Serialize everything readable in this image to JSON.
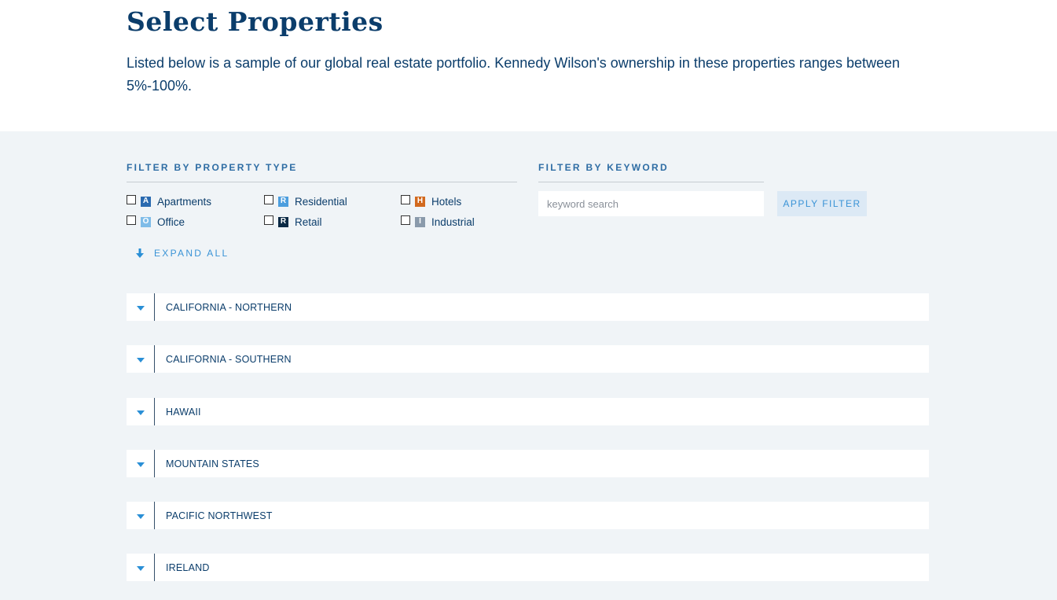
{
  "header": {
    "title": "Select Properties",
    "description": "Listed below is a sample of our global real estate portfolio. Kennedy Wilson's ownership in these properties ranges between 5%-100%."
  },
  "filters": {
    "property_type_label": "FILTER BY PROPERTY TYPE",
    "keyword_label": "FILTER BY KEYWORD",
    "types": [
      {
        "letter": "A",
        "label": "Apartments",
        "color": "#2a6ab0"
      },
      {
        "letter": "R",
        "label": "Residential",
        "color": "#4c9ede"
      },
      {
        "letter": "H",
        "label": "Hotels",
        "color": "#d2691e"
      },
      {
        "letter": "O",
        "label": "Office",
        "color": "#7fbce8"
      },
      {
        "letter": "R",
        "label": "Retail",
        "color": "#0b2a45"
      },
      {
        "letter": "I",
        "label": "Industrial",
        "color": "#8a9aab"
      }
    ],
    "keyword_placeholder": "keyword search",
    "apply_label": "APPLY FILTER"
  },
  "expand_all_label": "EXPAND ALL",
  "regions": [
    "CALIFORNIA - NORTHERN",
    "CALIFORNIA - SOUTHERN",
    "HAWAII",
    "MOUNTAIN STATES",
    "PACIFIC NORTHWEST",
    "IRELAND"
  ]
}
